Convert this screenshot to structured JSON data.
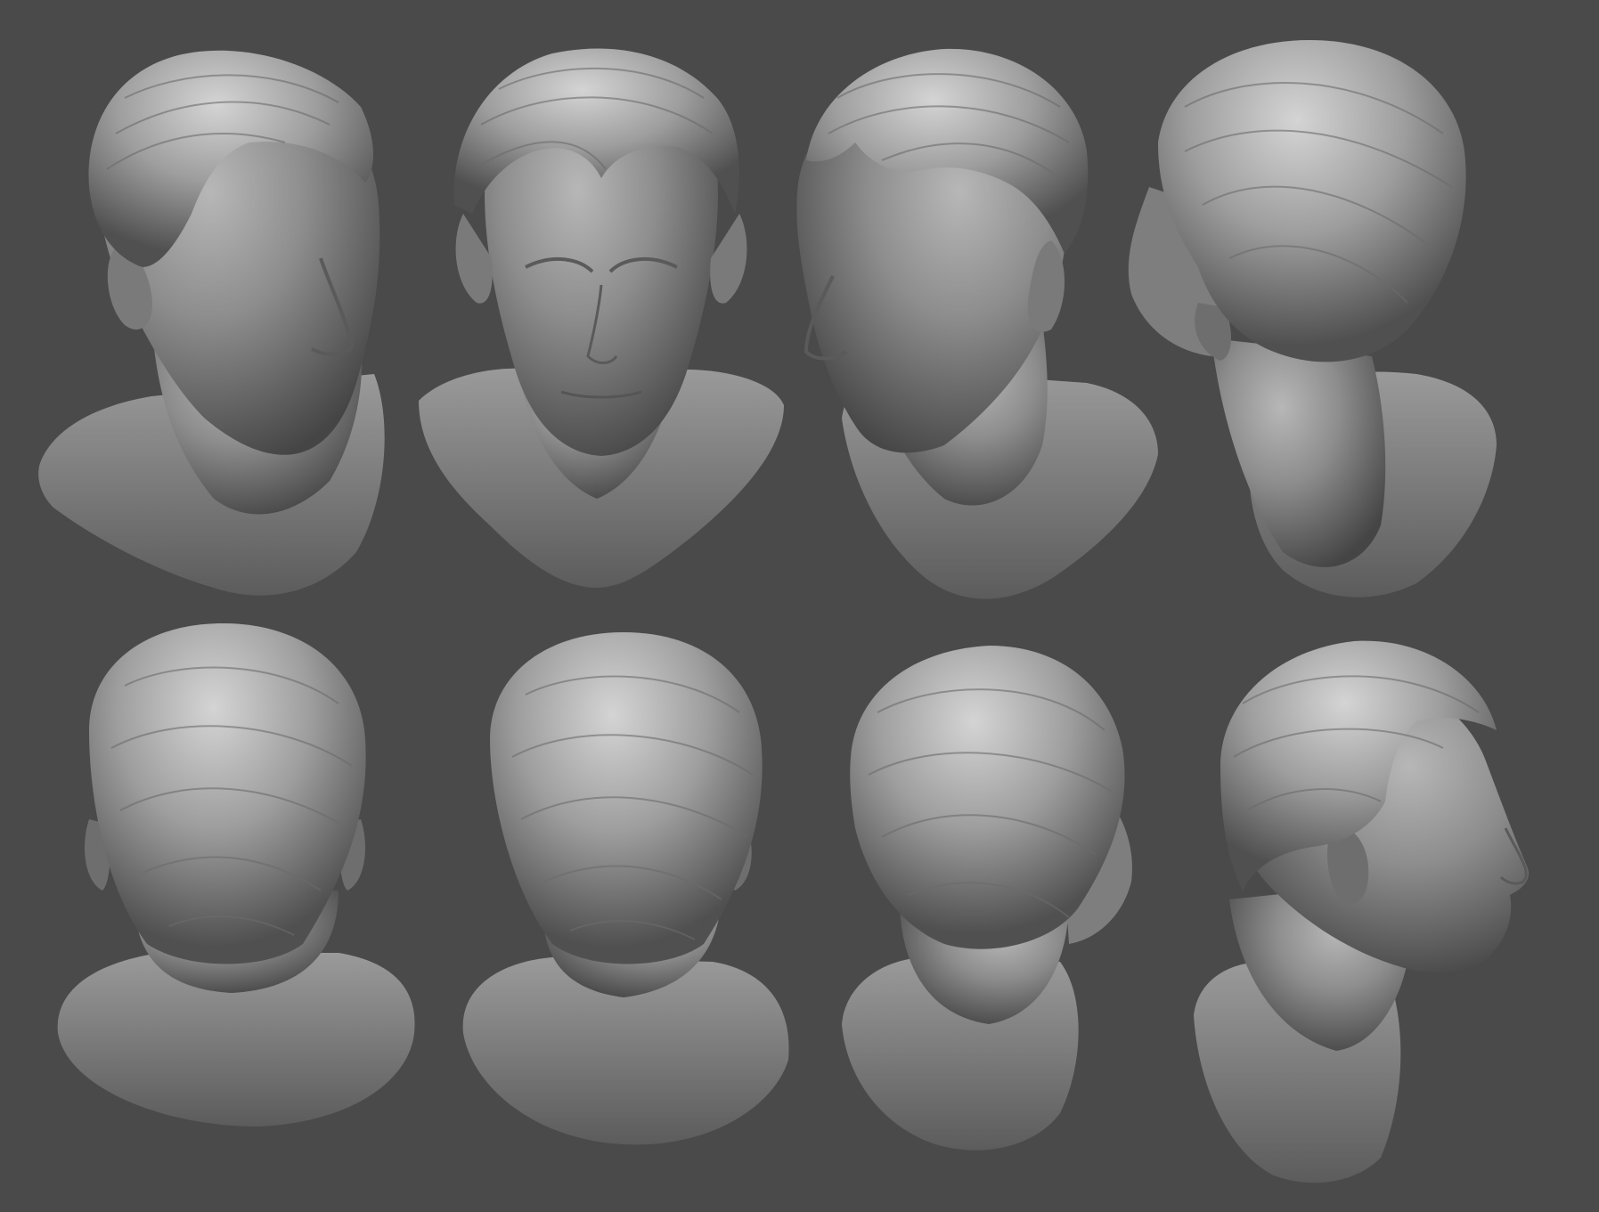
{
  "scene": {
    "background_color": "#4a4a4b",
    "material_color": "#9a9a9a",
    "views": [
      {
        "name": "front-three-quarter-left"
      },
      {
        "name": "front"
      },
      {
        "name": "front-three-quarter-right"
      },
      {
        "name": "back-three-quarter-left"
      },
      {
        "name": "back"
      },
      {
        "name": "back-slight-right"
      },
      {
        "name": "back-three-quarter-right"
      },
      {
        "name": "profile-right"
      }
    ]
  }
}
